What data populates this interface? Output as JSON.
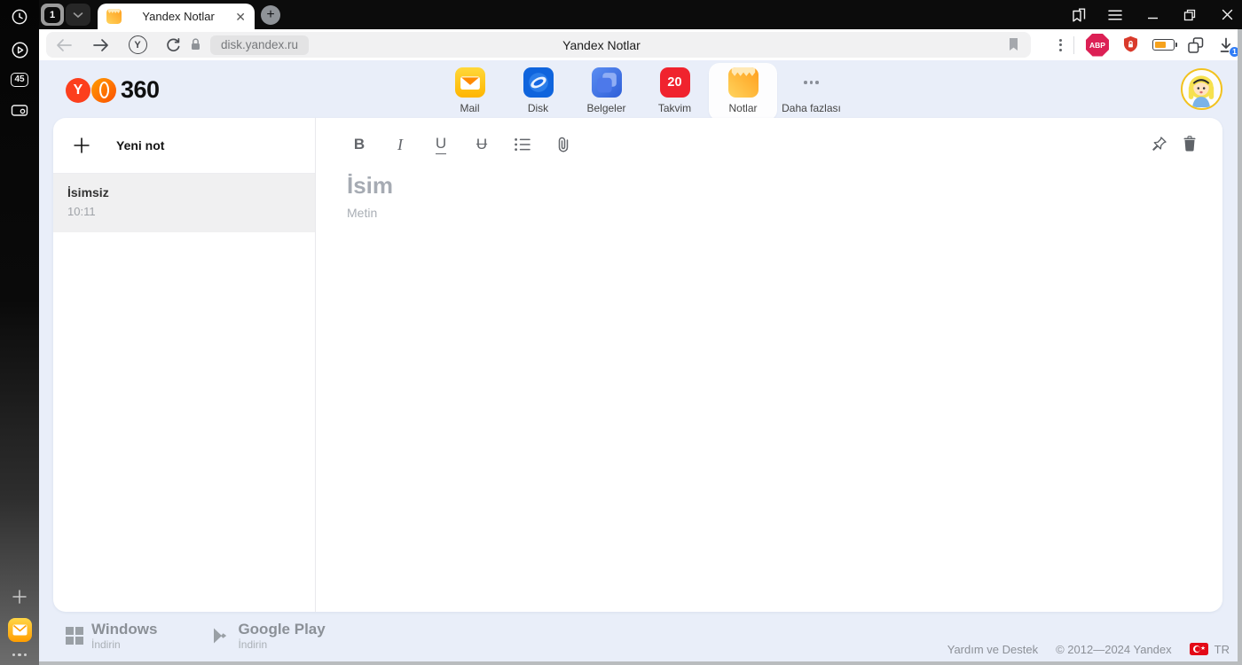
{
  "browser": {
    "side_rail": {
      "history_badge": "45"
    },
    "tab_strip": {
      "tab_counter": "1",
      "active_tab": {
        "title": "Yandex Notlar"
      }
    },
    "toolbar": {
      "yandex_button": "Y",
      "url": "disk.yandex.ru",
      "page_title": "Yandex Notlar",
      "adblock_label": "ABP",
      "download_badge": "1"
    }
  },
  "app_header": {
    "logo_y": "Y",
    "logo_suffix": "360",
    "apps": [
      {
        "label": "Mail"
      },
      {
        "label": "Disk"
      },
      {
        "label": "Belgeler"
      },
      {
        "label": "Takvim",
        "badge": "20"
      },
      {
        "label": "Notlar",
        "active": true
      },
      {
        "label": "Daha fazlası"
      }
    ]
  },
  "notes_panel": {
    "new_note_label": "Yeni not",
    "items": [
      {
        "title": "İsimsiz",
        "time": "10:11"
      }
    ]
  },
  "editor": {
    "toolbar": {
      "bold": "B",
      "italic": "I",
      "underline": "U",
      "strikethrough": "U"
    },
    "title_placeholder": "İsim",
    "body_placeholder": "Metin"
  },
  "footer": {
    "windows": {
      "name": "Windows",
      "action": "İndirin"
    },
    "google_play": {
      "name": "Google Play",
      "action": "İndirin"
    },
    "help": "Yardım ve Destek",
    "copyright": "© 2012—2024 Yandex",
    "locale": "TR"
  },
  "colors": {
    "page_bg": "#e9eef9",
    "yandex_red": "#fc3f1d",
    "notes_orange": "#ff9e1b",
    "takvim_red": "#f0232e",
    "badge_blue": "#2f7cf6",
    "abp_red": "#dc2055",
    "shield_red": "#d93a2b",
    "battery_orange": "#f6a21c",
    "flag_red": "#e30a17",
    "selected_note_bg": "#f0f0f1"
  }
}
